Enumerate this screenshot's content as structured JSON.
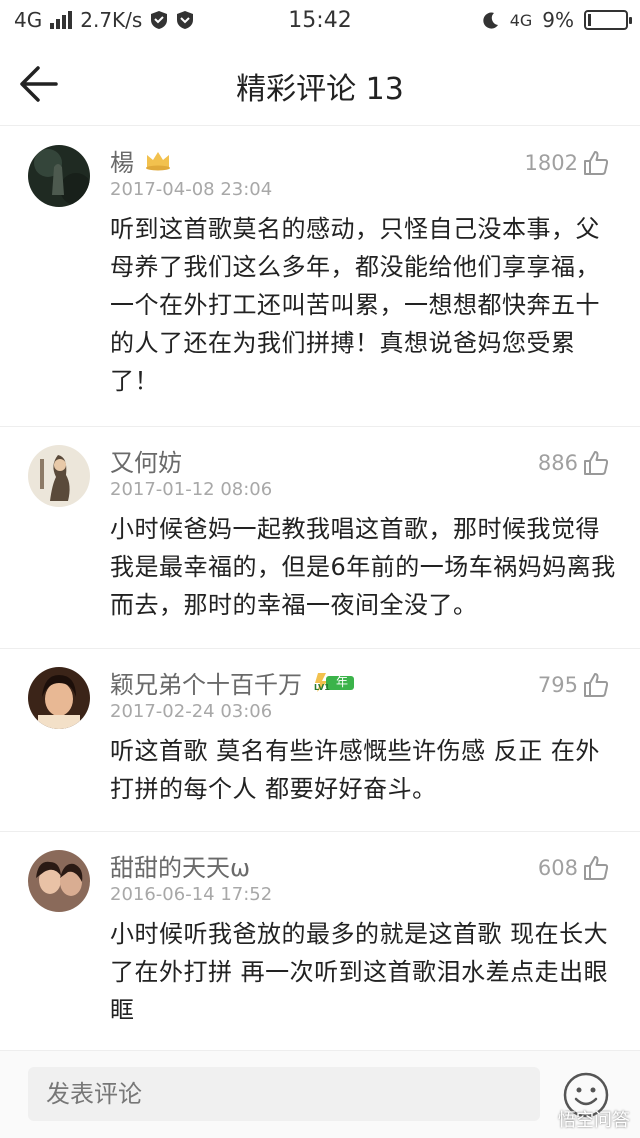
{
  "status_bar": {
    "network": "4G",
    "speed": "2.7K/s",
    "time": "15:42",
    "network_right": "4G",
    "battery": "9%",
    "battery_level": 0.09
  },
  "header": {
    "title": "精彩评论 13",
    "back_icon": "arrow-left-icon"
  },
  "comments": [
    {
      "user": "楊",
      "time": "2017-04-08 23:04",
      "likes": "1802",
      "text": "听到这首歌莫名的感动，只怪自己没本事，父母养了我们这么多年，都没能给他们享享福，一个在外打工还叫苦叫累，一想想都快奔五十的人了还在为我们拼搏！真想说爸妈您受累了！",
      "badge": "crown-icon"
    },
    {
      "user": "又何妨",
      "time": "2017-01-12 08:06",
      "likes": "886",
      "text": "小时候爸妈一起教我唱这首歌，那时候我觉得我是最幸福的，但是6年前的一场车祸妈妈离我而去，那时的幸福一夜间全没了。"
    },
    {
      "user": "颖兄弟个十百千万",
      "time": "2017-02-24 03:06",
      "likes": "795",
      "text": "听这首歌 莫名有些许感慨些许伤感 反正 在外打拼的每个人 都要好好奋斗。",
      "badge": "vip-level-icon",
      "badge_text_top": "年",
      "badge_text_bottom": "LV1"
    },
    {
      "user": "甜甜的天天ω",
      "time": "2016-06-14 17:52",
      "likes": "608",
      "text": "小时候听我爸放的最多的就是这首歌 现在长大了在外打拼 再一次听到这首歌泪水差点走出眼眶"
    }
  ],
  "bottom_bar": {
    "input_placeholder": "发表评论",
    "emoji_icon": "smiley-icon",
    "watermark": "悟空问答"
  },
  "colors": {
    "text_primary": "#222222",
    "text_secondary": "#6a6a6a",
    "text_muted": "#a8a8a8",
    "divider": "#eeeeee",
    "badge_gold": "#f2c14e",
    "badge_green": "#3bb34a"
  }
}
